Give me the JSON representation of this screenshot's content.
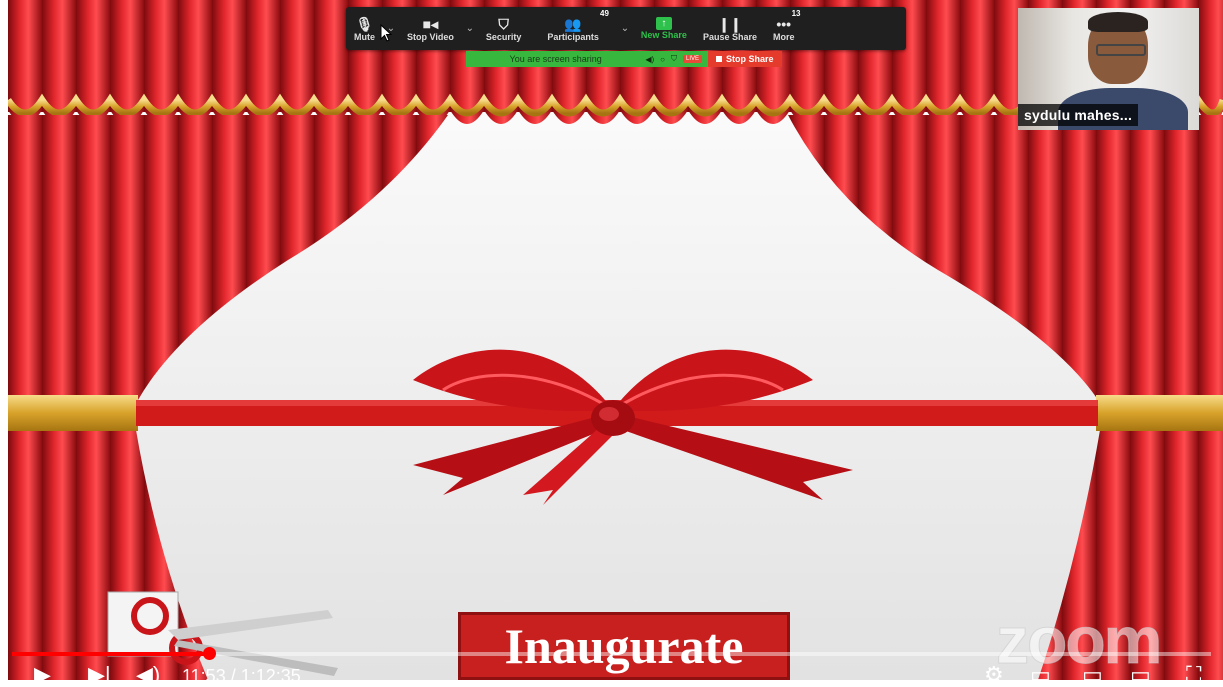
{
  "toolbar": {
    "mute_label": "Mute",
    "video_label": "Stop Video",
    "security_label": "Security",
    "participants_label": "Participants",
    "participants_count": "49",
    "new_share_label": "New Share",
    "pause_share_label": "Pause Share",
    "more_label": "More",
    "more_count": "13"
  },
  "sharing": {
    "status_text": "You are screen sharing",
    "live_label": "LIVE",
    "stop_label": "Stop Share"
  },
  "participant": {
    "name": "sydulu mahes..."
  },
  "slide": {
    "banner_text": "Inaugurate",
    "watermark": "zoom"
  },
  "player": {
    "time_display": "11:53 / 1:12:35",
    "progress_fraction": 0.164
  },
  "colors": {
    "curtain": "#c8141b",
    "gold": "#e3b33b",
    "ribbon": "#d11b1b",
    "zoom_green": "#2ec14b",
    "stop_red": "#e53b2c"
  }
}
